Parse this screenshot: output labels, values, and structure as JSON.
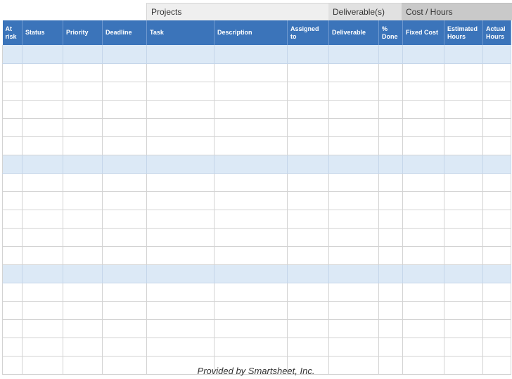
{
  "groups": {
    "projects": "Projects",
    "deliverables": "Deliverable(s)",
    "cost_hours": "Cost / Hours"
  },
  "columns": {
    "at_risk": "At risk",
    "status": "Status",
    "priority": "Priority",
    "deadline": "Deadline",
    "task": "Task",
    "description": "Description",
    "assigned_to": "Assigned to",
    "deliverable": "Deliverable",
    "pct_done": "% Done",
    "fixed_cost": "Fixed Cost",
    "estimated_hours": "Estimated Hours",
    "actual_hours": "Actual Hours"
  },
  "footer": "Provided by Smartsheet, Inc.",
  "colors": {
    "header": "#3b74ba",
    "section_row": "#dce9f6",
    "pct_done_col": "#d7dbe3",
    "fixed_cost_col": "#d9d9d9"
  }
}
